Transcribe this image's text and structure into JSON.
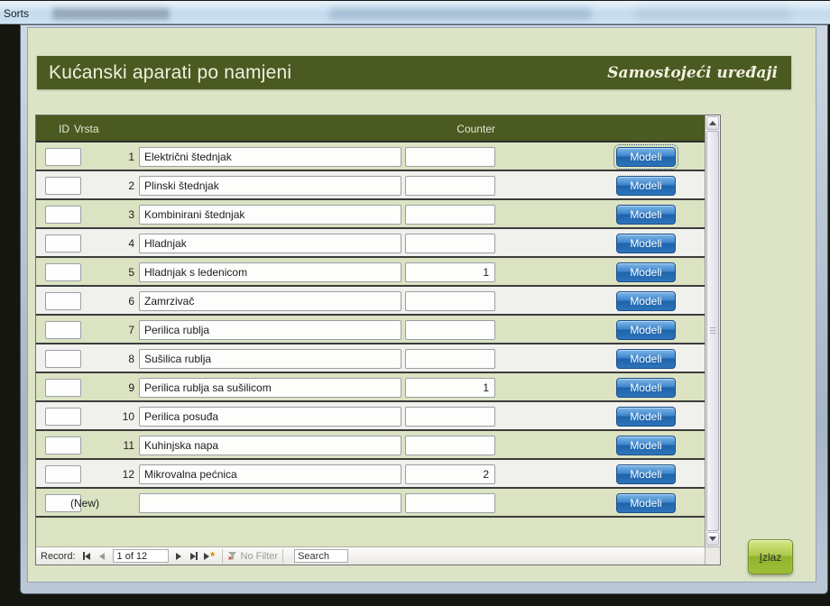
{
  "titlebar": {
    "app_label": "Sorts"
  },
  "banner": {
    "title": "Kućanski aparati po namjeni",
    "subtitle": "Samostojeći uređaji"
  },
  "table": {
    "columns": {
      "id": "ID",
      "vrsta": "Vrsta",
      "counter": "Counter"
    },
    "action_label": "Modeli",
    "rows": [
      {
        "id": "1",
        "vrsta": "Električni štednjak",
        "counter": ""
      },
      {
        "id": "2",
        "vrsta": "Plinski štednjak",
        "counter": ""
      },
      {
        "id": "3",
        "vrsta": "Kombinirani štednjak",
        "counter": ""
      },
      {
        "id": "4",
        "vrsta": "Hladnjak",
        "counter": ""
      },
      {
        "id": "5",
        "vrsta": "Hladnjak s ledenicom",
        "counter": "1"
      },
      {
        "id": "6",
        "vrsta": "Zamrzivač",
        "counter": ""
      },
      {
        "id": "7",
        "vrsta": "Perilica rublja",
        "counter": ""
      },
      {
        "id": "8",
        "vrsta": "Sušilica rublja",
        "counter": ""
      },
      {
        "id": "9",
        "vrsta": "Perilica rublja sa sušilicom",
        "counter": "1"
      },
      {
        "id": "10",
        "vrsta": "Perilica posuđa",
        "counter": ""
      },
      {
        "id": "11",
        "vrsta": "Kuhinjska napa",
        "counter": ""
      },
      {
        "id": "12",
        "vrsta": "Mikrovalna pećnica",
        "counter": "2"
      },
      {
        "id": "(New)",
        "vrsta": "",
        "counter": ""
      }
    ]
  },
  "record_nav": {
    "label": "Record:",
    "position": "1 of 12",
    "no_filter_label": "No Filter",
    "search_placeholder": "Search"
  },
  "exit_button": {
    "label": "Izlaz"
  },
  "colors": {
    "banner-bg": "#4a5a21",
    "form-bg": "#dde4c6",
    "row-green": "#dbe3c2",
    "row-white": "#f0f0ec",
    "action-blue": "#1e64ab",
    "exit-green": "#8fb32c"
  }
}
